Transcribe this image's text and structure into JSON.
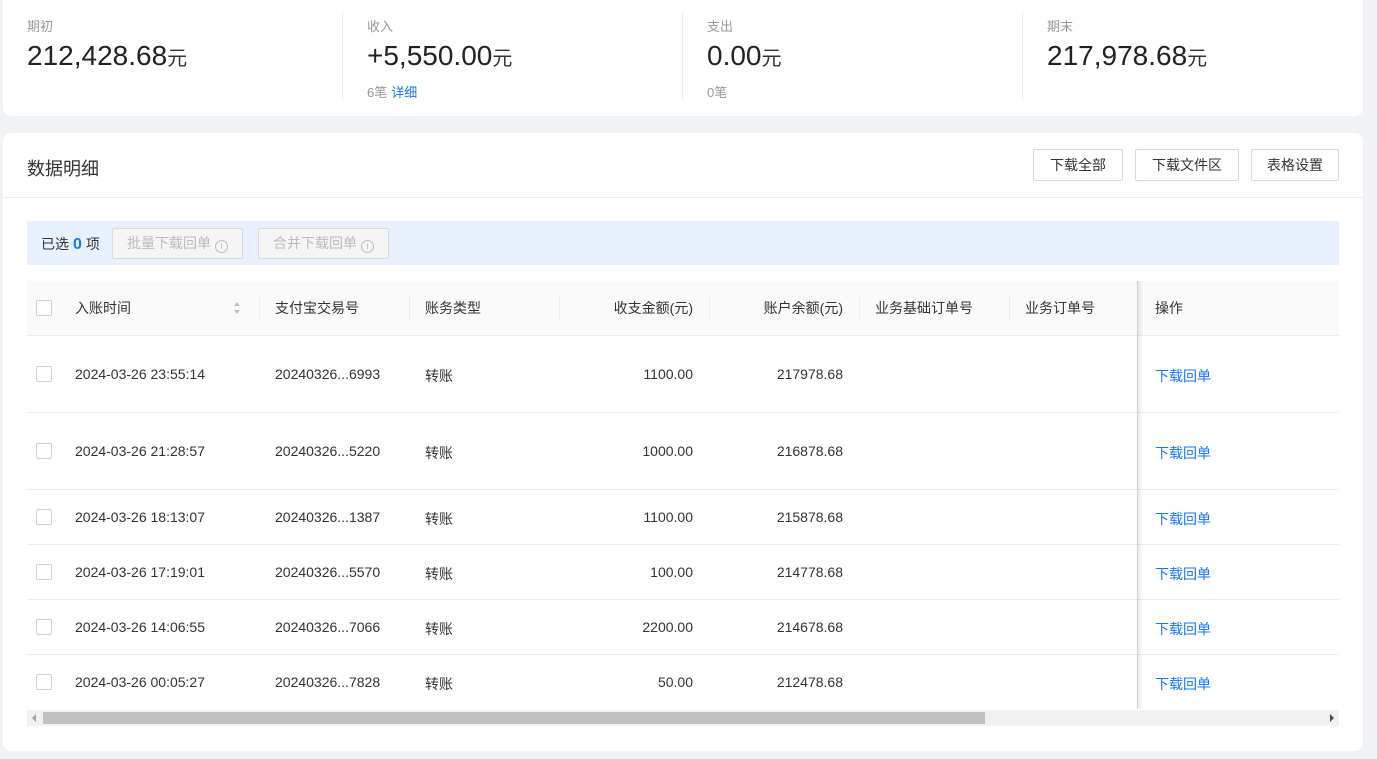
{
  "summary": [
    {
      "label": "期初",
      "value": "212,428.68",
      "unit": "元",
      "sub_count": "",
      "sub_link": ""
    },
    {
      "label": "收入",
      "value": "+5,550.00",
      "unit": "元",
      "sub_count": "6笔",
      "sub_link": "详细"
    },
    {
      "label": "支出",
      "value": "0.00",
      "unit": "元",
      "sub_count": "0笔",
      "sub_link": ""
    },
    {
      "label": "期末",
      "value": "217,978.68",
      "unit": "元",
      "sub_count": "",
      "sub_link": ""
    }
  ],
  "detail": {
    "title": "数据明细",
    "buttons": {
      "download_all": "下载全部",
      "download_area": "下载文件区",
      "table_settings": "表格设置"
    }
  },
  "selection": {
    "prefix": "已选",
    "count": "0",
    "suffix": "项",
    "batch_download": "批量下载回单",
    "merge_download": "合并下载回单"
  },
  "table": {
    "columns": [
      "入账时间",
      "支付宝交易号",
      "账务类型",
      "收支金额(元)",
      "账户余额(元)",
      "业务基础订单号",
      "业务订单号",
      "操作"
    ],
    "rows": [
      {
        "time": "2024-03-26 23:55:14",
        "trade_no": "20240326...6993",
        "type": "转账",
        "amount": "1100.00",
        "balance": "217978.68",
        "base_order": "",
        "order": "",
        "action": "下载回单"
      },
      {
        "time": "2024-03-26 21:28:57",
        "trade_no": "20240326...5220",
        "type": "转账",
        "amount": "1000.00",
        "balance": "216878.68",
        "base_order": "",
        "order": "",
        "action": "下载回单"
      },
      {
        "time": "2024-03-26 18:13:07",
        "trade_no": "20240326...1387",
        "type": "转账",
        "amount": "1100.00",
        "balance": "215878.68",
        "base_order": "",
        "order": "",
        "action": "下载回单"
      },
      {
        "time": "2024-03-26 17:19:01",
        "trade_no": "20240326...5570",
        "type": "转账",
        "amount": "100.00",
        "balance": "214778.68",
        "base_order": "",
        "order": "",
        "action": "下载回单"
      },
      {
        "time": "2024-03-26 14:06:55",
        "trade_no": "20240326...7066",
        "type": "转账",
        "amount": "2200.00",
        "balance": "214678.68",
        "base_order": "",
        "order": "",
        "action": "下载回单"
      },
      {
        "time": "2024-03-26 00:05:27",
        "trade_no": "20240326...7828",
        "type": "转账",
        "amount": "50.00",
        "balance": "212478.68",
        "base_order": "",
        "order": "",
        "action": "下载回单"
      }
    ]
  },
  "colors": {
    "accent": "#1677ff",
    "select_bar_bg": "#e8f1fd"
  }
}
